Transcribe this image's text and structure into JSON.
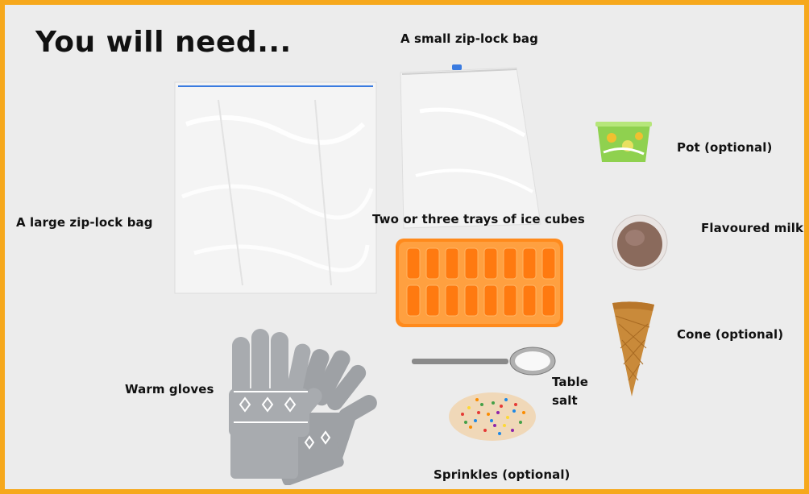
{
  "title": "You will need...",
  "labels": {
    "small_bag": "A small zip-lock bag",
    "large_bag": "A large zip-lock bag",
    "pot": "Pot (optional)",
    "ice_trays": "Two or three trays of ice cubes",
    "milk": "Flavoured milk",
    "cone": "Cone (optional)",
    "gloves": "Warm gloves",
    "salt_line1": "Table",
    "salt_line2": "salt",
    "sprinkles": "Sprinkles (optional)"
  },
  "colors": {
    "border": "#f6a81c",
    "background": "#ececec",
    "tray": "#ff8a1c",
    "zip_seal": "#3a7be0",
    "glove": "#a3a6aa",
    "cone": "#c98a3a",
    "pot": "#8fd14f",
    "milk": "#8a6a5c"
  }
}
